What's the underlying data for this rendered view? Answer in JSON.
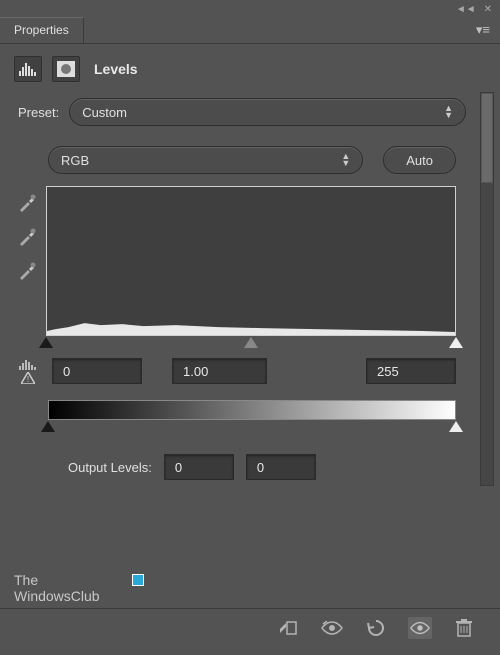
{
  "panel": {
    "title": "Properties",
    "adjustment_name": "Levels",
    "menu_icon": "panel-menu"
  },
  "preset": {
    "label": "Preset:",
    "value": "Custom"
  },
  "channel": {
    "value": "RGB",
    "auto_label": "Auto"
  },
  "input_levels": {
    "black": "0",
    "mid": "1.00",
    "white": "255"
  },
  "output_levels": {
    "label": "Output Levels:",
    "black": "0",
    "white": "0"
  },
  "watermark": {
    "line1": "The",
    "line2": "WindowsClub"
  },
  "icons": {
    "collapse": "◄◄",
    "close": "✕",
    "clip": "clip-to-layer",
    "prev": "view-previous",
    "reset": "reset",
    "visibility": "toggle-visibility",
    "trash": "delete"
  }
}
